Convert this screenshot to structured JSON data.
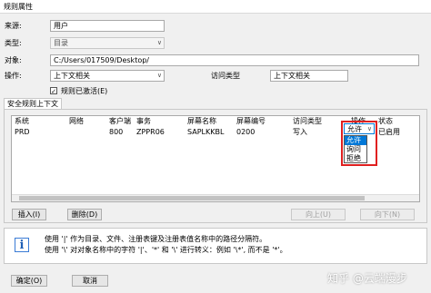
{
  "window": {
    "title": "规则属性"
  },
  "form": {
    "source_label": "来源:",
    "source_value": "用户",
    "type_label": "类型:",
    "type_value": "目录",
    "object_label": "对象:",
    "object_value": "C:/Users/017509/Desktop/",
    "operation_label": "操作:",
    "operation_value": "上下文相关",
    "access_type_label": "访问类型",
    "access_type_value": "上下文相关",
    "activated_label": "规则已激活(E)",
    "activated_checked": "✓"
  },
  "context_section": {
    "title": "安全规则上下文"
  },
  "table": {
    "headers": [
      "系统",
      "网络",
      "客户端",
      "事务",
      "屏幕名称",
      "屏幕编号",
      "访问类型",
      "操作",
      "状态"
    ],
    "rows": [
      {
        "system": "PRD",
        "network": "",
        "client": "800",
        "transaction": "ZPPR06",
        "screen_name": "SAPLKKBL",
        "screen_number": "0200",
        "access_type": "写入",
        "operation": "允许",
        "status": "已启用"
      }
    ],
    "dropdown_options": [
      "允许",
      "询问",
      "拒绝"
    ]
  },
  "buttons": {
    "insert": "插入(I)",
    "delete": "删除(D)",
    "up": "向上(U)",
    "down": "向下(N)",
    "ok": "确定(O)",
    "cancel": "取消"
  },
  "info": {
    "line1": "使用 '|' 作为目录、文件、注册表键及注册表值名称中的路径分隔符。",
    "line2": "使用 '\\' 对对象名称中的字符 '|'、'*' 和 '\\' 进行转义：例如 '\\*', 而不是 '*'。"
  },
  "watermark": "知乎 @云端漫步"
}
